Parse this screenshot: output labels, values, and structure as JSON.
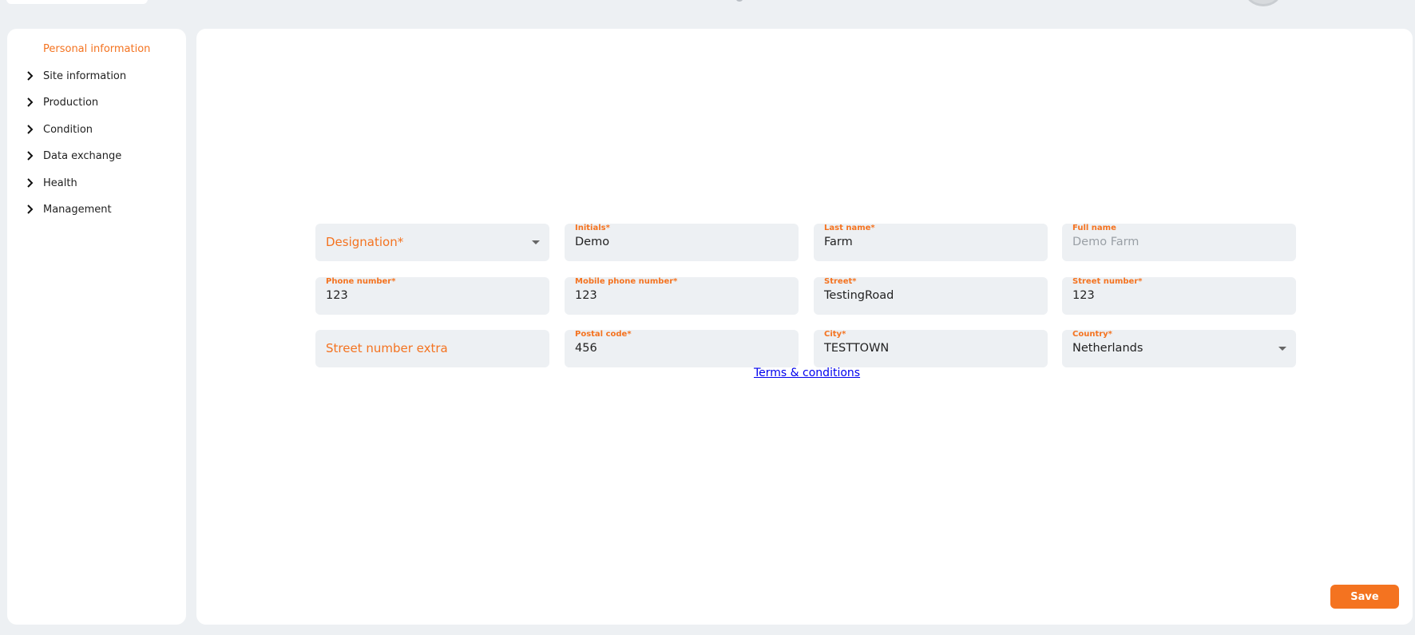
{
  "sidebar": {
    "items": [
      {
        "label": "Personal information",
        "active": true
      },
      {
        "label": "Site information"
      },
      {
        "label": "Production"
      },
      {
        "label": "Condition"
      },
      {
        "label": "Data exchange"
      },
      {
        "label": "Health"
      },
      {
        "label": "Management"
      }
    ]
  },
  "form": {
    "designation": {
      "placeholder": "Designation*"
    },
    "initials": {
      "label": "Initials*",
      "value": "Demo"
    },
    "last_name": {
      "label": "Last name*",
      "value": "Farm"
    },
    "full_name": {
      "label": "Full name",
      "value": "Demo Farm"
    },
    "phone_number": {
      "label": "Phone number*",
      "value": "123"
    },
    "mobile_phone_number": {
      "label": "Mobile phone number*",
      "value": "123"
    },
    "street": {
      "label": "Street*",
      "value": "TestingRoad"
    },
    "street_number": {
      "label": "Street number*",
      "value": "123"
    },
    "street_number_extra": {
      "placeholder": "Street number extra"
    },
    "postal_code": {
      "label": "Postal code*",
      "value": "456"
    },
    "city": {
      "label": "City*",
      "value": "TESTTOWN"
    },
    "country": {
      "label": "Country*",
      "value": "Netherlands"
    }
  },
  "terms_link": "Terms & conditions",
  "save_label": "Save",
  "colors": {
    "accent": "#f47320",
    "background": "#edf0f3",
    "panel": "#ffffff",
    "link": "#0000ee"
  },
  "icons": {
    "sidebar_chevron": "chevron-right-icon",
    "select_caret": "caret-down-icon"
  }
}
